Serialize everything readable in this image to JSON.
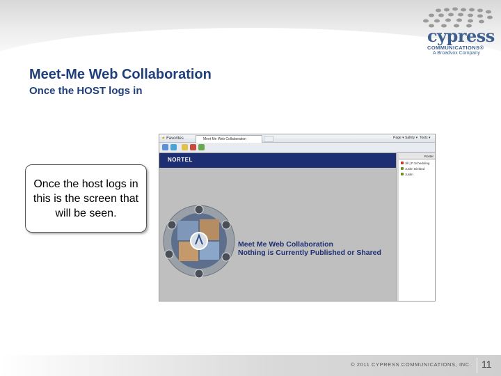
{
  "slide": {
    "title": "Meet-Me Web Collaboration",
    "subtitle": "Once the HOST logs in",
    "callout": "Once the host logs in this is the screen that will be seen.",
    "footer": {
      "copyright": "© 2011 CYPRESS COMMUNICATIONS, INC.",
      "page_number": "11"
    }
  },
  "logo": {
    "wordmark": "cypress",
    "line1": "COMMUNICATIONS®",
    "line2": "A Broadvox Company",
    "color": "#3d5f8f"
  },
  "browser": {
    "favorites_label": "Favorites",
    "tab_label": "Meet Me Web Collaboration",
    "commands": [
      "Page ▾",
      "Safety ▾",
      "Tools ▾"
    ],
    "nortel_logo": "NORTEL",
    "panel": {
      "header": "Roster",
      "rows": [
        {
          "label": "Jill | P   Scheduling",
          "color": "#c0392b"
        },
        {
          "label": "Justin Dieland",
          "color": "#6b8e23"
        },
        {
          "label": "Justin",
          "color": "#6b8e23"
        }
      ]
    },
    "status_line1": "Meet Me Web Collaboration",
    "status_line2": "Nothing is Currently Published or Shared"
  },
  "colors": {
    "title": "#1f3f7a",
    "nortel_bar": "#1d2e73"
  }
}
